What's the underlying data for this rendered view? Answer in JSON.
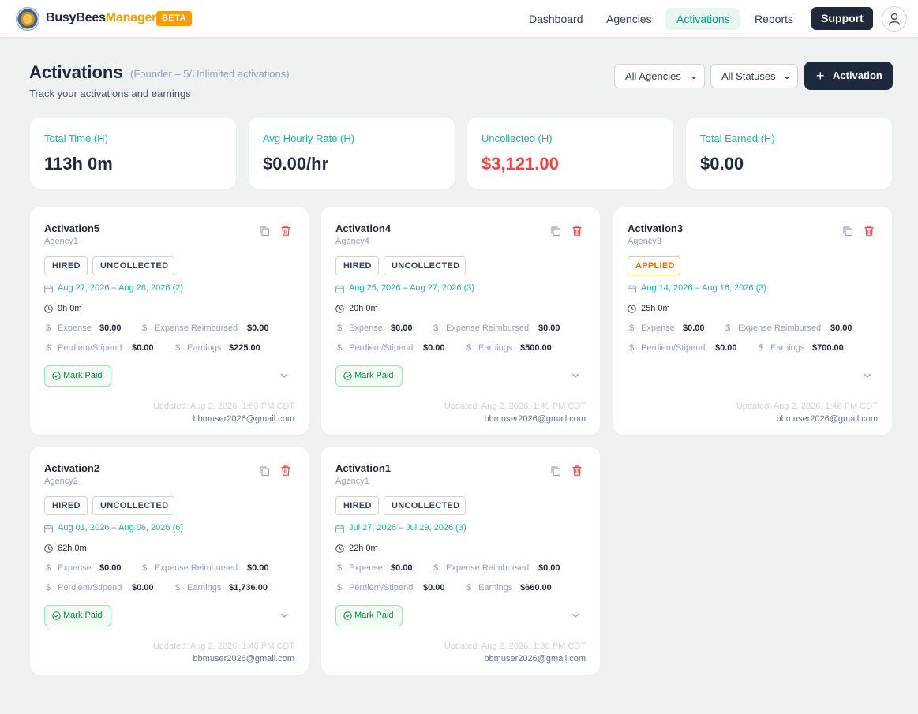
{
  "header": {
    "brand_main": "BusyBees",
    "brand_accent": "Manager",
    "beta": "BETA",
    "nav": [
      "Dashboard",
      "Agencies",
      "Activations",
      "Reports"
    ],
    "active_nav": "Activations",
    "support": "Support"
  },
  "page": {
    "title": "Activations",
    "plan": "(Founder – 5/Unlimited activations)",
    "description": "Track your activations and earnings",
    "agency_filter": "All Agencies",
    "status_filter": "All Statuses",
    "add_label": "Activation"
  },
  "stats": [
    {
      "label": "Total Time (H)",
      "value": "113h 0m"
    },
    {
      "label": "Avg Hourly Rate (H)",
      "value": "$0.00/hr"
    },
    {
      "label": "Uncollected (H)",
      "value": "$3,121.00"
    },
    {
      "label": "Total Earned (H)",
      "value": "$0.00"
    }
  ],
  "labels": {
    "expense": "Expense",
    "expense_reimbursed": "Expense Reimbursed",
    "perdiem": "Perdiem/Stipend",
    "earnings": "Earnings",
    "mark_paid": "Mark Paid",
    "dollar": "$"
  },
  "activations": [
    {
      "name": "Activation5",
      "agency": "Agency1",
      "badges": [
        "HIRED",
        "UNCOLLECTED"
      ],
      "dates": "Aug 27, 2026 – Aug 28, 2026 (2)",
      "hours": "9h 0m",
      "expense": "$0.00",
      "expense_reimbursed": "$0.00",
      "perdiem": "$0.00",
      "earnings": "$225.00",
      "mark_paid": true,
      "updated": "Updated: Aug 2, 2026, 1:50 PM CDT",
      "email": "bbmuser2026@gmail.com"
    },
    {
      "name": "Activation4",
      "agency": "Agency4",
      "badges": [
        "HIRED",
        "UNCOLLECTED"
      ],
      "dates": "Aug 25, 2026 – Aug 27, 2026 (3)",
      "hours": "20h 0m",
      "expense": "$0.00",
      "expense_reimbursed": "$0.00",
      "perdiem": "$0.00",
      "earnings": "$500.00",
      "mark_paid": true,
      "updated": "Updated: Aug 2, 2026, 1:49 PM CDT",
      "email": "bbmuser2026@gmail.com"
    },
    {
      "name": "Activation3",
      "agency": "Agency3",
      "badges": [
        "APPLIED"
      ],
      "dates": "Aug 14, 2026 – Aug 16, 2026 (3)",
      "hours": "25h 0m",
      "expense": "$0.00",
      "expense_reimbursed": "$0.00",
      "perdiem": "$0.00",
      "earnings": "$700.00",
      "mark_paid": false,
      "updated": "Updated: Aug 2, 2026, 1:46 PM CDT",
      "email": "bbmuser2026@gmail.com"
    },
    {
      "name": "Activation2",
      "agency": "Agency2",
      "badges": [
        "HIRED",
        "UNCOLLECTED"
      ],
      "dates": "Aug 01, 2026 – Aug 06, 2026 (6)",
      "hours": "62h 0m",
      "expense": "$0.00",
      "expense_reimbursed": "$0.00",
      "perdiem": "$0.00",
      "earnings": "$1,736.00",
      "mark_paid": true,
      "updated": "Updated: Aug 2, 2026, 1:46 PM CDT",
      "email": "bbmuser2026@gmail.com"
    },
    {
      "name": "Activation1",
      "agency": "Agency1",
      "badges": [
        "HIRED",
        "UNCOLLECTED"
      ],
      "dates": "Jul 27, 2026 – Jul 29, 2026 (3)",
      "hours": "22h 0m",
      "expense": "$0.00",
      "expense_reimbursed": "$0.00",
      "perdiem": "$0.00",
      "earnings": "$660.00",
      "mark_paid": true,
      "updated": "Updated: Aug 2, 2026, 1:30 PM CDT",
      "email": "bbmuser2026@gmail.com"
    }
  ],
  "colors": {
    "accent": "#14b8a6",
    "brand": "#f59e0b",
    "dark": "#1e293b",
    "danger": "#ef4444"
  }
}
